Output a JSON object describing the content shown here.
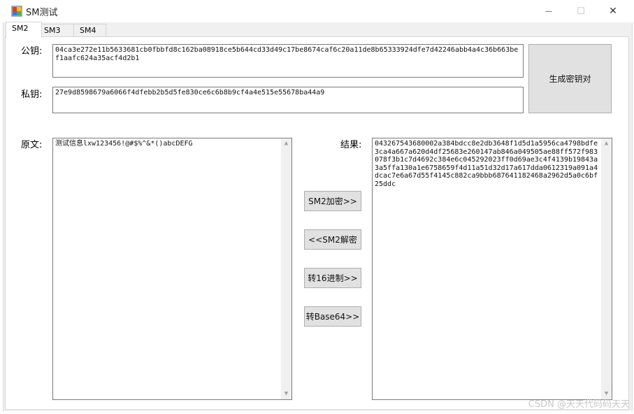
{
  "window": {
    "title": "SM测试",
    "minimize_glyph": "—",
    "maximize_glyph": "☐",
    "close_glyph": "✕"
  },
  "tabs": [
    {
      "label": "SM2",
      "active": true
    },
    {
      "label": "SM3",
      "active": false
    },
    {
      "label": "SM4",
      "active": false
    }
  ],
  "form": {
    "public_key_label": "公钥:",
    "public_key_value": "04ca3e272e11b5633681cb0fbbfd8c162ba08918ce5b644cd33d49c17be8674caf6c20a11de8b65333924dfe7d42246abb4a4c36b663bef1aafc624a35acf4d2b1",
    "private_key_label": "私钥:",
    "private_key_value": "27e9d8598679a6066f4dfebb2b5d5fe830ce6c6b8b9cf4a4e515e55678ba44a9",
    "generate_button": "生成密钥对",
    "plaintext_label": "原文:",
    "plaintext_value": "测试信息lxw123456!@#$%^&*()abcDEFG",
    "result_label": "结果:",
    "result_value": "043267543680002a384bdcc8e2db3648f1d5d1a5956ca4798bdfe3ca4a667a620d4df25683e260147ab846a049505ae88ff572f983078f3b1c7d4692c384e6c045292023ff0d69ae3c4f4139b19843a3a5ffa130a1e6758659f4d11a51d32d17a617dda0612319a091a4dcac7e6a67d55f4145c882ca9bbb687641182468a2962d5a0c6bf25ddc"
  },
  "buttons": {
    "encrypt": "SM2加密>>",
    "decrypt": "<<SM2解密",
    "to_hex": "转16进制>>",
    "to_base64": "转Base64>>"
  },
  "watermark": "CSDN @天天代码码天天",
  "colors": {
    "accent": "#0078d7"
  }
}
